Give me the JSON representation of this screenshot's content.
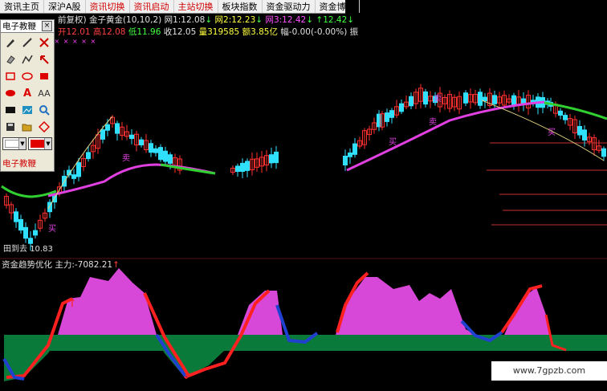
{
  "menu": [
    {
      "label": "资讯主页",
      "red": false
    },
    {
      "label": "深沪A股",
      "red": false
    },
    {
      "label": "资讯切换",
      "red": true
    },
    {
      "label": "资讯启动",
      "red": true
    },
    {
      "label": "主站切换",
      "red": true
    },
    {
      "label": "板块指数",
      "red": false
    },
    {
      "label": "资金驱动力",
      "red": false
    },
    {
      "label": "资金博弈",
      "red": false
    }
  ],
  "info_row1": {
    "prefix": "前复权)",
    "indicator": "金子黄金(10,10,2)",
    "w1_label": "网1:",
    "w1_value": "12.08",
    "w2_label": "网2:",
    "w2_value": "12.23",
    "w3_label": "网3:",
    "w3_value": "12.42",
    "w4_value": "12.42"
  },
  "info_row2": {
    "open_label": "开",
    "open": "12.01",
    "high_label": "高",
    "high": "12.08",
    "low_label": "低",
    "low": "11.96",
    "close_label": "收",
    "close": "12.05",
    "vol_label": "量",
    "vol": "319585",
    "amt_label": "额",
    "amt": "3.85亿",
    "chg_label": "幅",
    "chg": "-0.00(-0.00%)",
    "suffix": "振"
  },
  "x_marks": "× × × ×         ×         ×              ×                ×                     ×         ×          ×",
  "toolbox": {
    "title": "电子教鞭",
    "footer": "电子教鞭",
    "close_glyph": "×",
    "tools": [
      "pen-icon",
      "line-icon",
      "cross-arrow-icon",
      "eraser-icon",
      "polyline-icon",
      "arrow-icon",
      "rect-icon",
      "ellipse-icon",
      "filled-rect-icon",
      "filled-ellipse-icon",
      "text-icon",
      "font-icon",
      "screen-icon",
      "image-icon",
      "magnifier-icon",
      "save-icon",
      "open-icon",
      "diamond-icon"
    ],
    "font_label": "AA",
    "text_label": "A"
  },
  "price_low_label": "10.83",
  "indicator_panel": {
    "title": "资金趋势优化",
    "main_label": "主力:",
    "main_value": "-7082.21",
    "arrow": "↑"
  },
  "candle_labels": {
    "buy": "买",
    "sell": "卖"
  },
  "watermark": "www.7gpzb.com",
  "colors": {
    "up": "#ff3030",
    "down": "#30e0ff",
    "ma_green": "#30d030",
    "ma_magenta": "#e040e0",
    "money_magenta": "#d848d8",
    "money_green": "#0a7a3a",
    "trend_red": "#ff2020",
    "trend_blue": "#2040d0"
  }
}
